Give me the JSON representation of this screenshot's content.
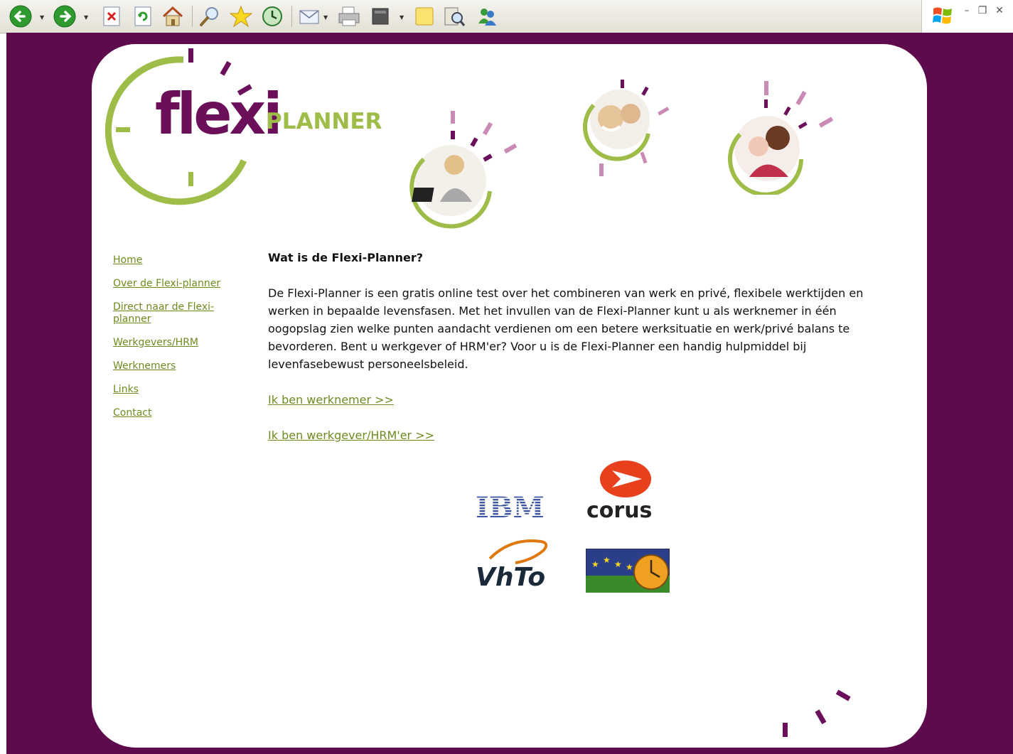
{
  "browser": {
    "toolbar_icons": [
      {
        "name": "back-icon",
        "glyph": "←"
      },
      {
        "name": "forward-icon",
        "glyph": "→"
      },
      {
        "name": "stop-icon",
        "glyph": "✖"
      },
      {
        "name": "refresh-icon",
        "glyph": "↻"
      },
      {
        "name": "home-icon",
        "glyph": "⌂"
      },
      {
        "name": "search-icon",
        "glyph": "⌕"
      },
      {
        "name": "favorites-icon",
        "glyph": "★"
      },
      {
        "name": "history-icon",
        "glyph": "⌚"
      },
      {
        "name": "mail-icon",
        "glyph": "✉"
      },
      {
        "name": "print-icon",
        "glyph": "⎙"
      },
      {
        "name": "edit-icon",
        "glyph": "■"
      },
      {
        "name": "notes-icon",
        "glyph": "□"
      },
      {
        "name": "research-icon",
        "glyph": "⌘"
      },
      {
        "name": "messenger-icon",
        "glyph": "☺"
      }
    ],
    "window_controls": {
      "minimize": "–",
      "restore": "❐",
      "close": "✕"
    }
  },
  "site": {
    "brand_flexi": "flexi",
    "brand_planner": "PLANNER"
  },
  "nav": [
    "Home",
    "Over de Flexi-planner",
    "Direct naar de Flexi-planner",
    "Werkgevers/HRM",
    "Werknemers",
    "Links",
    "Contact"
  ],
  "main": {
    "heading": "Wat is de Flexi-Planner?",
    "intro": "De Flexi-Planner is een gratis online test over het combineren van werk en privé, flexibele werktijden en werken in bepaalde levensfasen. Met het invullen van de Flexi-Planner kunt u als werknemer in één oogopslag zien welke punten aandacht verdienen om een betere werksituatie en werk/privé balans te bevorderen. Bent u werkgever of HRM'er? Voor u is de Flexi-Planner een handig hulpmiddel bij levenfasebewust personeelsbeleid.",
    "link_employee": "Ik ben werknemer >>",
    "link_employer": "Ik ben werkgever/HRM'er >>"
  },
  "sponsors": {
    "ibm": "IBM",
    "corus": "corus",
    "vhto": "VhTo"
  },
  "colors": {
    "background": "#5e0b4d",
    "brand_purple": "#6b0f5a",
    "brand_green": "#9dbd48",
    "link_green": "#6f8a1e",
    "accent_pink": "#c98ab4"
  }
}
